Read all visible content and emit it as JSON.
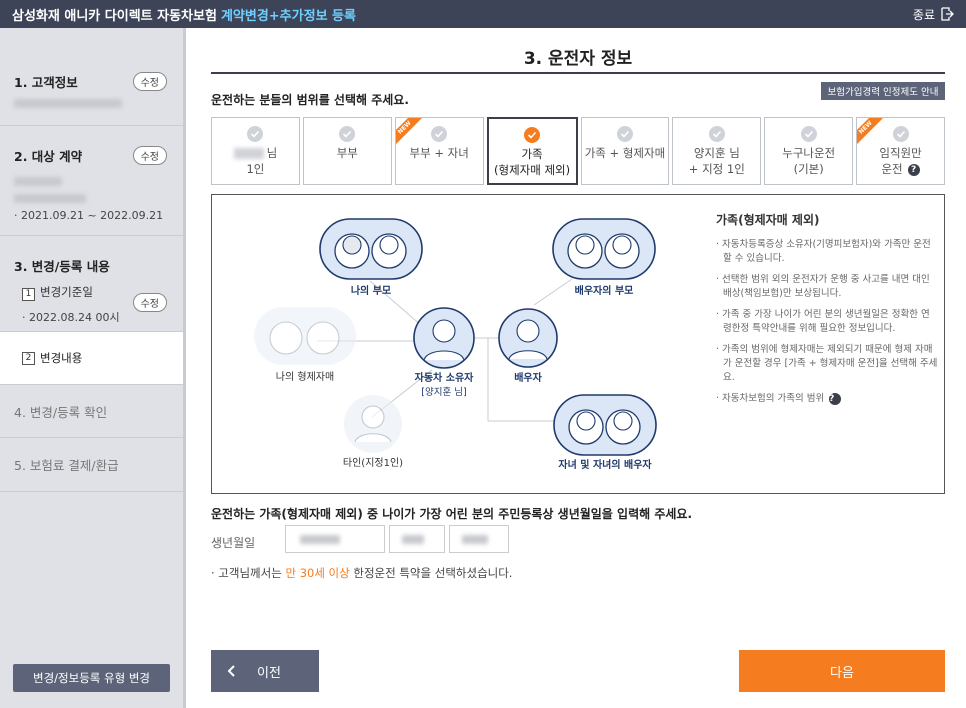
{
  "topbar": {
    "title": "삼성화재 애니카 다이렉트 자동차보험",
    "subtitle": "계약변경+추가정보 등록",
    "close_label": "종료"
  },
  "sidebar": {
    "steps": [
      {
        "label": "1. 고객정보",
        "edit": "수정"
      },
      {
        "label": "2. 대상 계약",
        "edit": "수정",
        "period": "· 2021.09.21 ~ 2022.09.21"
      },
      {
        "label": "3. 변경/등록 내용",
        "sub1_num": "1",
        "sub1_label": "변경기준일",
        "edit": "수정",
        "sub1_value": "· 2022.08.24 00시"
      },
      {
        "sub2_num": "2",
        "sub2_label": "변경내용"
      },
      {
        "label": "4. 변경/등록 확인"
      },
      {
        "label": "5. 보험료 결제/환급"
      }
    ],
    "bottom_button": "변경/정보등록 유형 변경"
  },
  "main": {
    "title": "3. 운전자 정보",
    "question": "운전하는 분들의 범위를 선택해 주세요.",
    "guide_button": "보험가입경력 인정제도 안내",
    "options": [
      {
        "l1": "님",
        "l2": "1인",
        "new": false,
        "selected": false
      },
      {
        "l1": "부부",
        "l2": "",
        "new": false,
        "selected": false
      },
      {
        "l1": "부부 + 자녀",
        "l2": "",
        "new": true,
        "selected": false
      },
      {
        "l1": "가족",
        "l2": "(형제자매 제외)",
        "new": false,
        "selected": true
      },
      {
        "l1": "가족 + 형제자매",
        "l2": "",
        "new": false,
        "selected": false
      },
      {
        "l1": "양지훈 님",
        "l2": "+ 지정 1인",
        "new": false,
        "selected": false
      },
      {
        "l1": "누구나운전",
        "l2": "(기본)",
        "new": false,
        "selected": false
      },
      {
        "l1": "임직원만",
        "l2": "운전",
        "new": true,
        "selected": false
      }
    ],
    "new_badge": "NEW",
    "diagram": {
      "my_parents": "나의 부모",
      "spouse_parents": "배우자의 부모",
      "my_siblings": "나의 형제자매",
      "owner": "자동차 소유자",
      "owner_name": "[양지훈 님]",
      "spouse": "배우자",
      "designated": "타인(지정1인)",
      "children": "자녀 및 자녀의 배우자"
    },
    "info": {
      "title": "가족(형제자매 제외)",
      "items": [
        "· 자동차등록증상 소유자(기명피보험자)와 가족만 운전할 수 있습니다.",
        "· 선택한 범위 외의 운전자가 운행 중 사고를 내면 대인배상(책임보험)만 보상됩니다.",
        "· 가족 중 가장 나이가 어린 분의 생년월일은 정확한 연령한정 특약안내를 위해 필요한 정보입니다.",
        "· 가족의 범위에 형제자매는 제외되기 때문에 형제 자매가 운전할 경우 [가족 + 형제자매 운전]을 선택해 주세요.",
        "· 자동차보험의 가족의 범위"
      ]
    },
    "birth_question": "운전하는 가족(형제자매 제외) 중 나이가 가장 어린 분의 주민등록상 생년월일을 입력해 주세요.",
    "birth_label": "생년월일",
    "note_prefix": "· 고객님께서는 ",
    "note_highlight": "만 30세 이상",
    "note_suffix": " 한정운전 특약을 선택하셨습니다.",
    "prev_label": "이전",
    "next_label": "다음"
  },
  "colors": {
    "accent": "#f57c1f",
    "navy": "#3d4458",
    "sidebar_bg": "#dfe1e6",
    "diagram_circle": "#dbe7f6"
  }
}
